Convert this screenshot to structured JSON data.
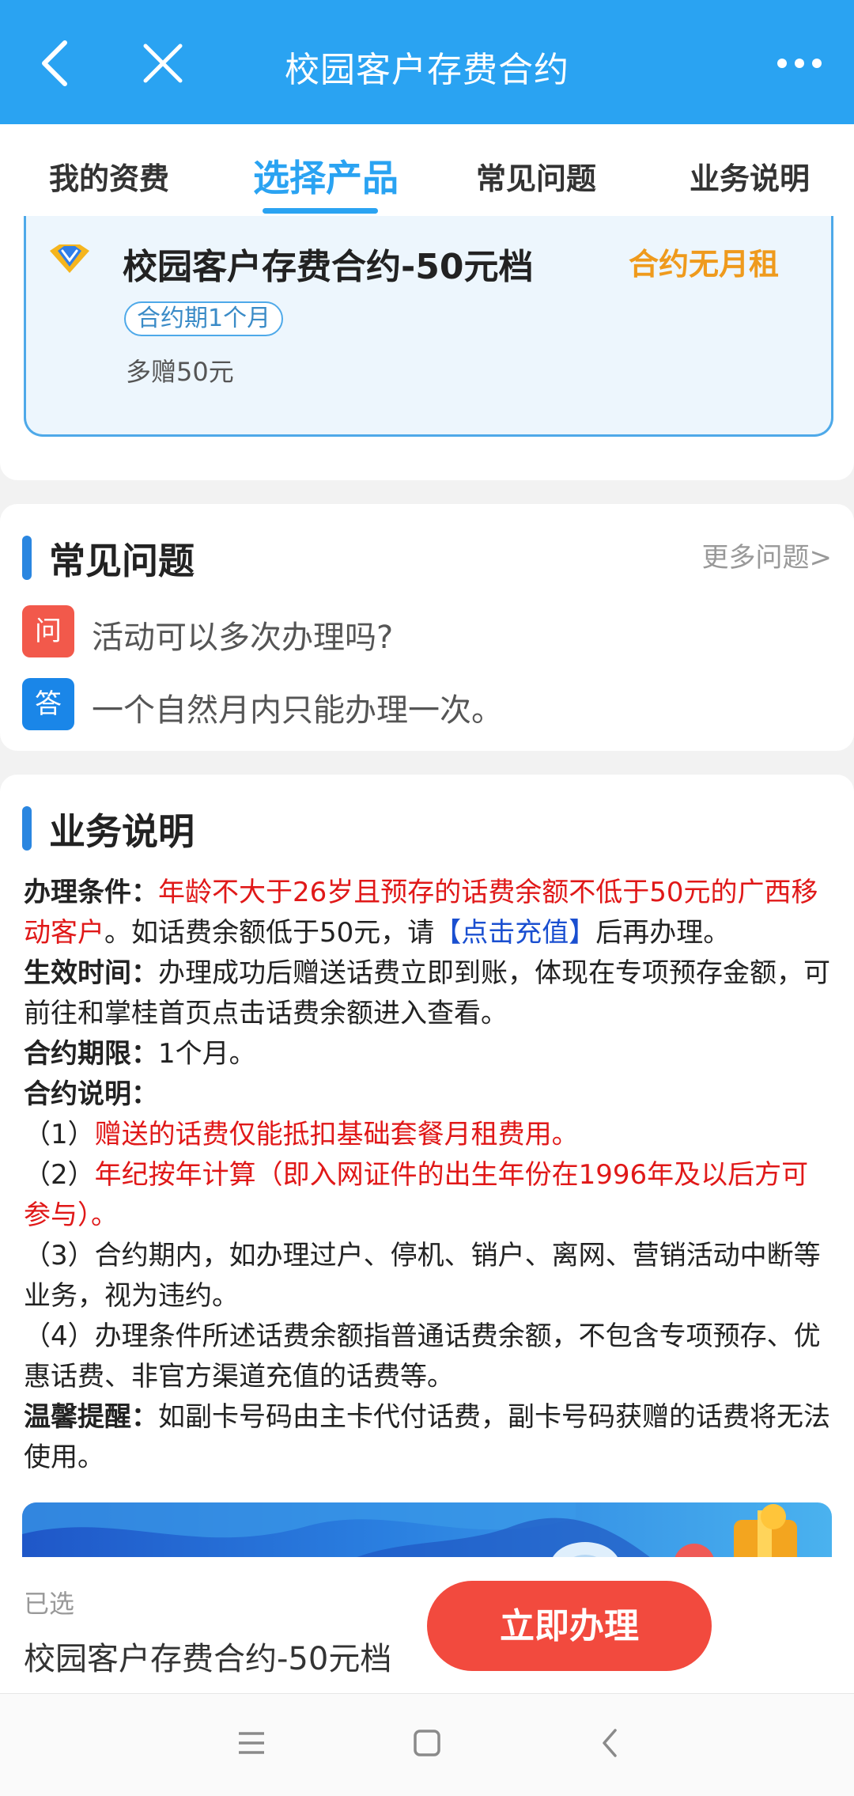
{
  "header": {
    "title": "校园客户存费合约"
  },
  "tabs": [
    {
      "label": "我的资费",
      "active": false
    },
    {
      "label": "选择产品",
      "active": true
    },
    {
      "label": "常见问题",
      "active": false
    },
    {
      "label": "业务说明",
      "active": false
    }
  ],
  "product": {
    "name": "校园客户存费合约-50元档",
    "rent_note": "合约无月租",
    "period_tag": "合约期1个月",
    "bonus": "多赠50元"
  },
  "faq": {
    "title": "常见问题",
    "more_link": "更多问题>",
    "question_badge": "问",
    "question": "活动可以多次办理吗?",
    "answer_badge": "答",
    "answer": "一个自然月内只能办理一次。"
  },
  "business": {
    "title": "业务说明",
    "cond_label": "办理条件：",
    "cond_red": "年龄不大于26岁且预存的话费余额不低于50元的广西移动客户",
    "cond_mid": "。如话费余额低于50元，请",
    "cond_link": "【点击充值】",
    "cond_end": "后再办理。",
    "effect_label": "生效时间：",
    "effect_text": "办理成功后赠送话费立即到账，体现在专项预存金额，可前往和掌桂首页点击话费余额进入查看。",
    "term_label": "合约期限：",
    "term_text": "1个月。",
    "notes_label": "合约说明：",
    "note1_num": "（1）",
    "note1": "赠送的话费仅能抵扣基础套餐月租费用。",
    "note2_num": "（2）",
    "note2": "年纪按年计算（即入网证件的出生年份在1996年及以后方可参与）。",
    "note3": "（3）合约期内，如办理过户、停机、销户、离网、营销活动中断等业务，视为违约。",
    "note4": "（4）办理条件所述话费余额指普通话费余额，不包含专项预存、优惠话费、非官方渠道充值的话费等。",
    "tip_label": "温馨提醒：",
    "tip_text": "如副卡号码由主卡代付话费，副卡号码获赠的话费将无法使用。"
  },
  "bottom": {
    "selected_label": "已选",
    "selected_value": "校园客户存费合约-50元档",
    "cta_label": "立即办理"
  },
  "colors": {
    "header_bg": "#2aa3f2",
    "accent_blue": "#2aa3f2",
    "warning_orange": "#ef9a1c",
    "emphasis_red": "#e01818",
    "cta_red": "#f24a3e",
    "question_badge": "#f2594b",
    "answer_badge": "#1a86e8"
  },
  "icons": [
    "back-arrow-icon",
    "close-icon",
    "more-dots-icon",
    "diamond-badge-icon",
    "nav-menu-icon",
    "nav-home-icon",
    "nav-back-icon"
  ]
}
